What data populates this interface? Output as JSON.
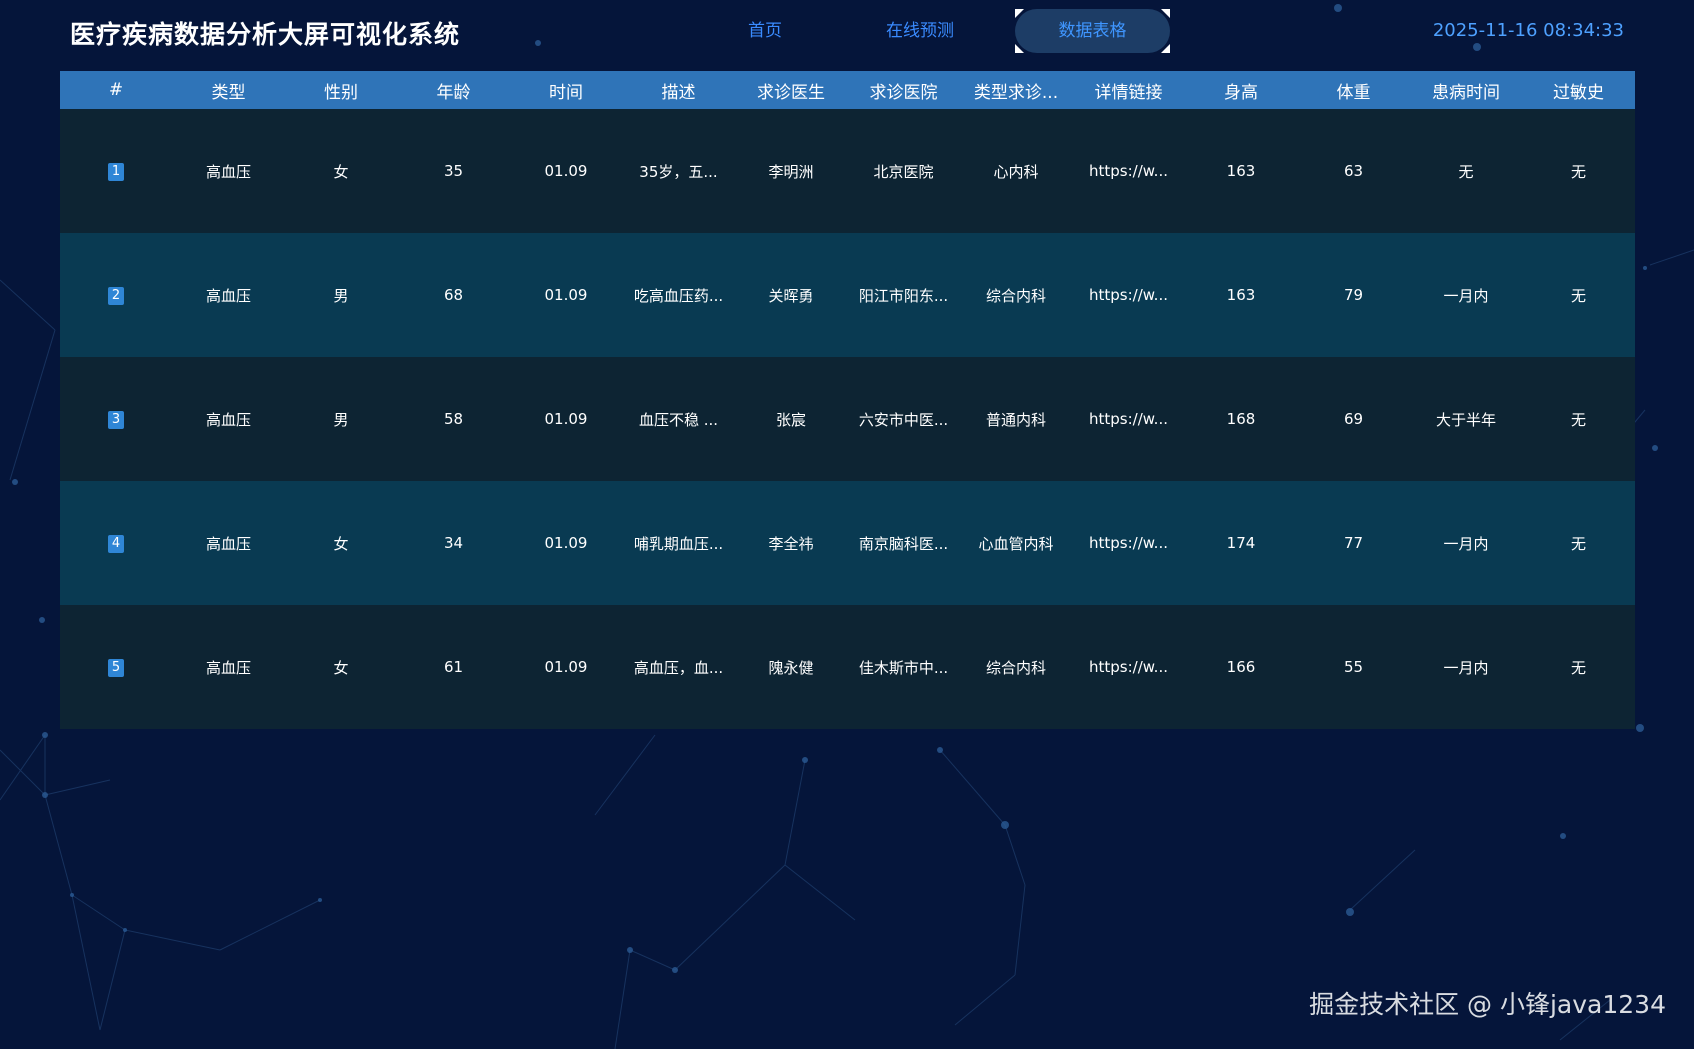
{
  "header": {
    "title": "医疗疾病数据分析大屏可视化系统",
    "datetime": "2025-11-16 08:34:33",
    "nav_tabs": [
      {
        "label": "首页"
      },
      {
        "label": "在线预测"
      },
      {
        "label": "数据表格",
        "active": true
      }
    ]
  },
  "table": {
    "columns": [
      "#",
      "类型",
      "性别",
      "年龄",
      "时间",
      "描述",
      "求诊医生",
      "求诊医院",
      "类型求诊...",
      "详情链接",
      "身高",
      "体重",
      "患病时间",
      "过敏史"
    ],
    "rows": [
      [
        "1",
        "高血压",
        "女",
        "35",
        "01.09",
        "35岁，五...",
        "李明洲",
        "北京医院",
        "心内科",
        "https://w...",
        "163",
        "63",
        "无",
        "无"
      ],
      [
        "2",
        "高血压",
        "男",
        "68",
        "01.09",
        "吃高血压药...",
        "关晖勇",
        "阳江市阳东...",
        "综合内科",
        "https://w...",
        "163",
        "79",
        "一月内",
        "无"
      ],
      [
        "3",
        "高血压",
        "男",
        "58",
        "01.09",
        "血压不稳 ...",
        "张宸",
        "六安市中医...",
        "普通内科",
        "https://w...",
        "168",
        "69",
        "大于半年",
        "无"
      ],
      [
        "4",
        "高血压",
        "女",
        "34",
        "01.09",
        "哺乳期血压...",
        "李全祎",
        "南京脑科医...",
        "心血管内科",
        "https://w...",
        "174",
        "77",
        "一月内",
        "无"
      ],
      [
        "5",
        "高血压",
        "女",
        "61",
        "01.09",
        "高血压，血...",
        "隗永健",
        "佳木斯市中...",
        "综合内科",
        "https://w...",
        "166",
        "55",
        "一月内",
        "无"
      ]
    ]
  },
  "watermark": "掘金技术社区 @ 小锋java1234",
  "colors": {
    "background": "#05153a",
    "header_row": "#2f74b8",
    "row_odd": "#0d2433",
    "row_even": "#093a52",
    "accent": "#3a8bff",
    "badge": "#2f86d6"
  }
}
